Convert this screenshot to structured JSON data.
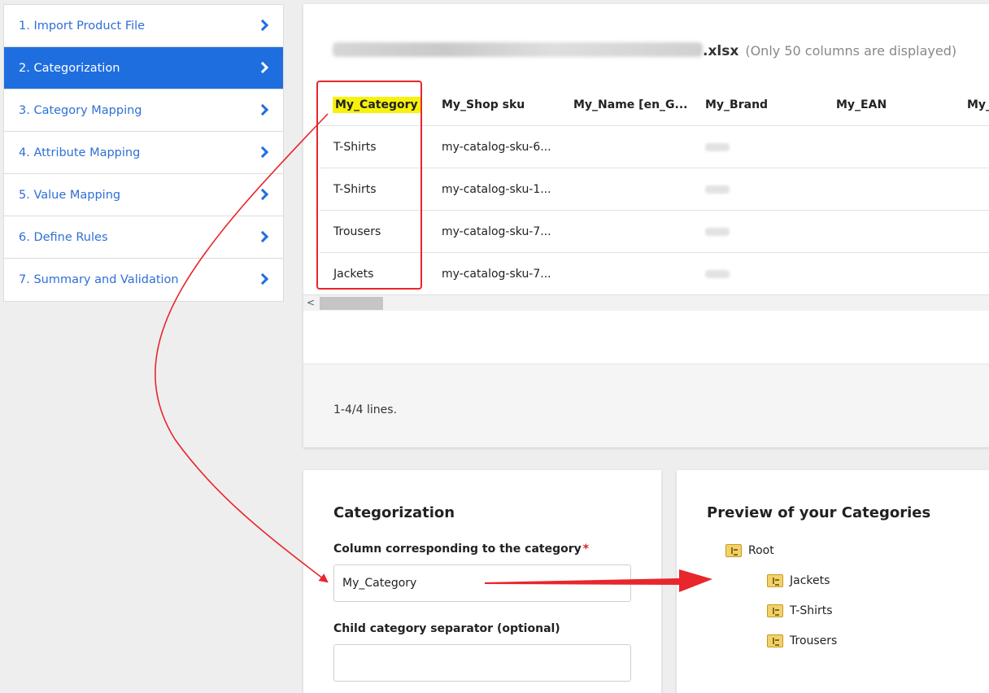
{
  "sidebar": {
    "items": [
      {
        "label": "1. Import Product File"
      },
      {
        "label": "2. Categorization"
      },
      {
        "label": "3. Category Mapping"
      },
      {
        "label": "4. Attribute Mapping"
      },
      {
        "label": "5. Value Mapping"
      },
      {
        "label": "6. Define Rules"
      },
      {
        "label": "7. Summary and Validation"
      }
    ]
  },
  "preview": {
    "file_ext": ".xlsx",
    "note": "(Only 50 columns are displayed)",
    "columns": [
      "My_Category",
      "My_Shop sku",
      "My_Name [en_G...",
      "My_Brand",
      "My_EAN",
      "My_"
    ],
    "rows": [
      [
        "T-Shirts",
        "my-catalog-sku-6..."
      ],
      [
        "T-Shirts",
        "my-catalog-sku-1..."
      ],
      [
        "Trousers",
        "my-catalog-sku-7..."
      ],
      [
        "Jackets",
        "my-catalog-sku-7..."
      ]
    ],
    "scroll_left": "<",
    "lines": "1-4/4 lines."
  },
  "categorization": {
    "title": "Categorization",
    "column_label": "Column corresponding to the category",
    "required_mark": "*",
    "column_value": "My_Category",
    "separator_label": "Child category separator (optional)"
  },
  "categories_preview": {
    "title": "Preview of your Categories",
    "root": "Root",
    "children": [
      "Jackets",
      "T-Shirts",
      "Trousers"
    ]
  },
  "colors": {
    "accent": "#1f6ee0",
    "highlight": "#f7f20b",
    "annotation_red": "#e8262c"
  }
}
